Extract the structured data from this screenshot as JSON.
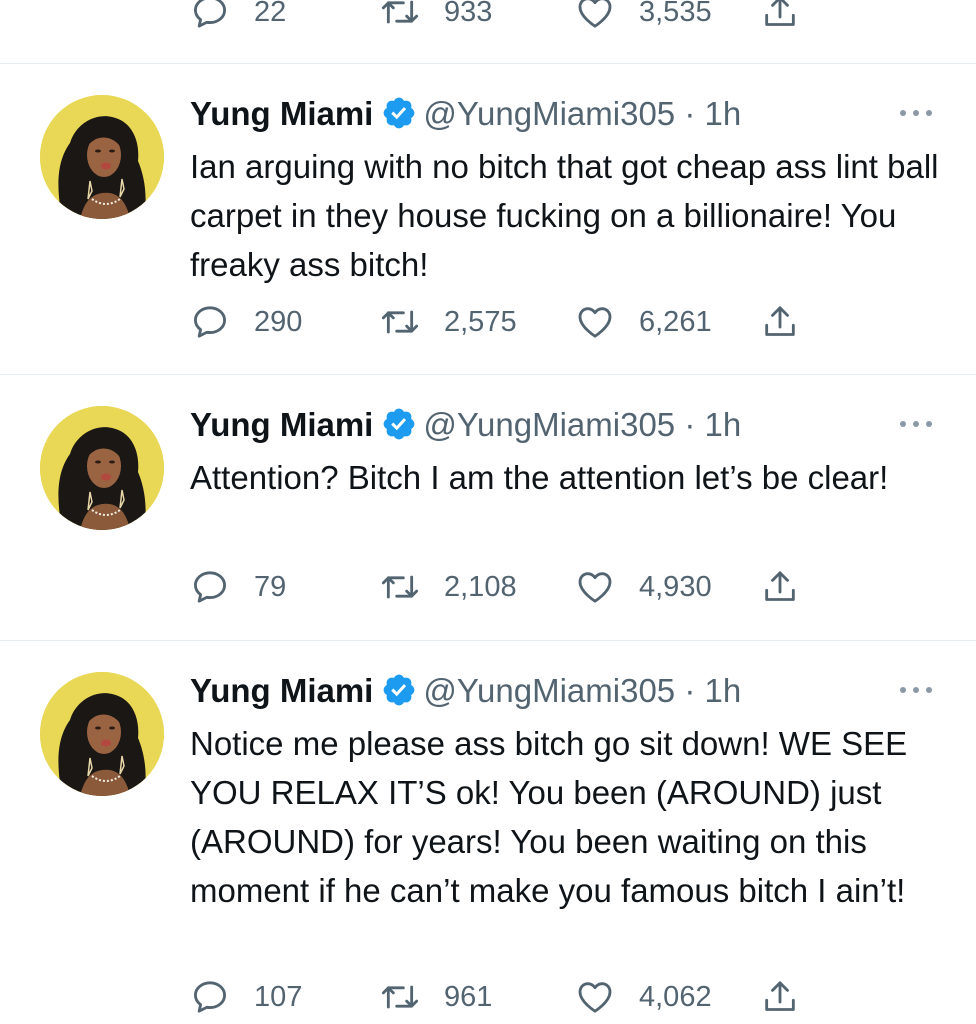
{
  "tweets": [
    {
      "partial": true,
      "reply_count": "22",
      "retweet_count": "933",
      "like_count": "3,535"
    },
    {
      "name": "Yung Miami",
      "handle": "@YungMiami305",
      "separator": "·",
      "time": "1h",
      "text": "Ian arguing with no bitch that got cheap ass lint ball carpet in they house fucking on a billionaire! You freaky ass bitch!",
      "reply_count": "290",
      "retweet_count": "2,575",
      "like_count": "6,261"
    },
    {
      "name": "Yung Miami",
      "handle": "@YungMiami305",
      "separator": "·",
      "time": "1h",
      "text": "Attention? Bitch I am the attention let’s be clear!",
      "reply_count": "79",
      "retweet_count": "2,108",
      "like_count": "4,930"
    },
    {
      "name": "Yung Miami",
      "handle": "@YungMiami305",
      "separator": "·",
      "time": "1h",
      "text": "Notice me please ass bitch go sit down! WE SEE YOU RELAX IT’S ok! You been (AROUND) just (AROUND) for years! You been waiting on this moment if he can’t make you famous bitch I ain’t!",
      "reply_count": "107",
      "retweet_count": "961",
      "like_count": "4,062"
    }
  ],
  "icons": {
    "reply": "speech-bubble-icon",
    "retweet": "retweet-arrows-icon",
    "like": "heart-outline-icon",
    "share": "share-upload-icon",
    "verified": "verified-badge-icon",
    "more": "more-dots-icon"
  },
  "colors": {
    "verified_badge": "#1d9bf0",
    "secondary_text": "#536471",
    "avatar_bg": "#e9d856"
  }
}
